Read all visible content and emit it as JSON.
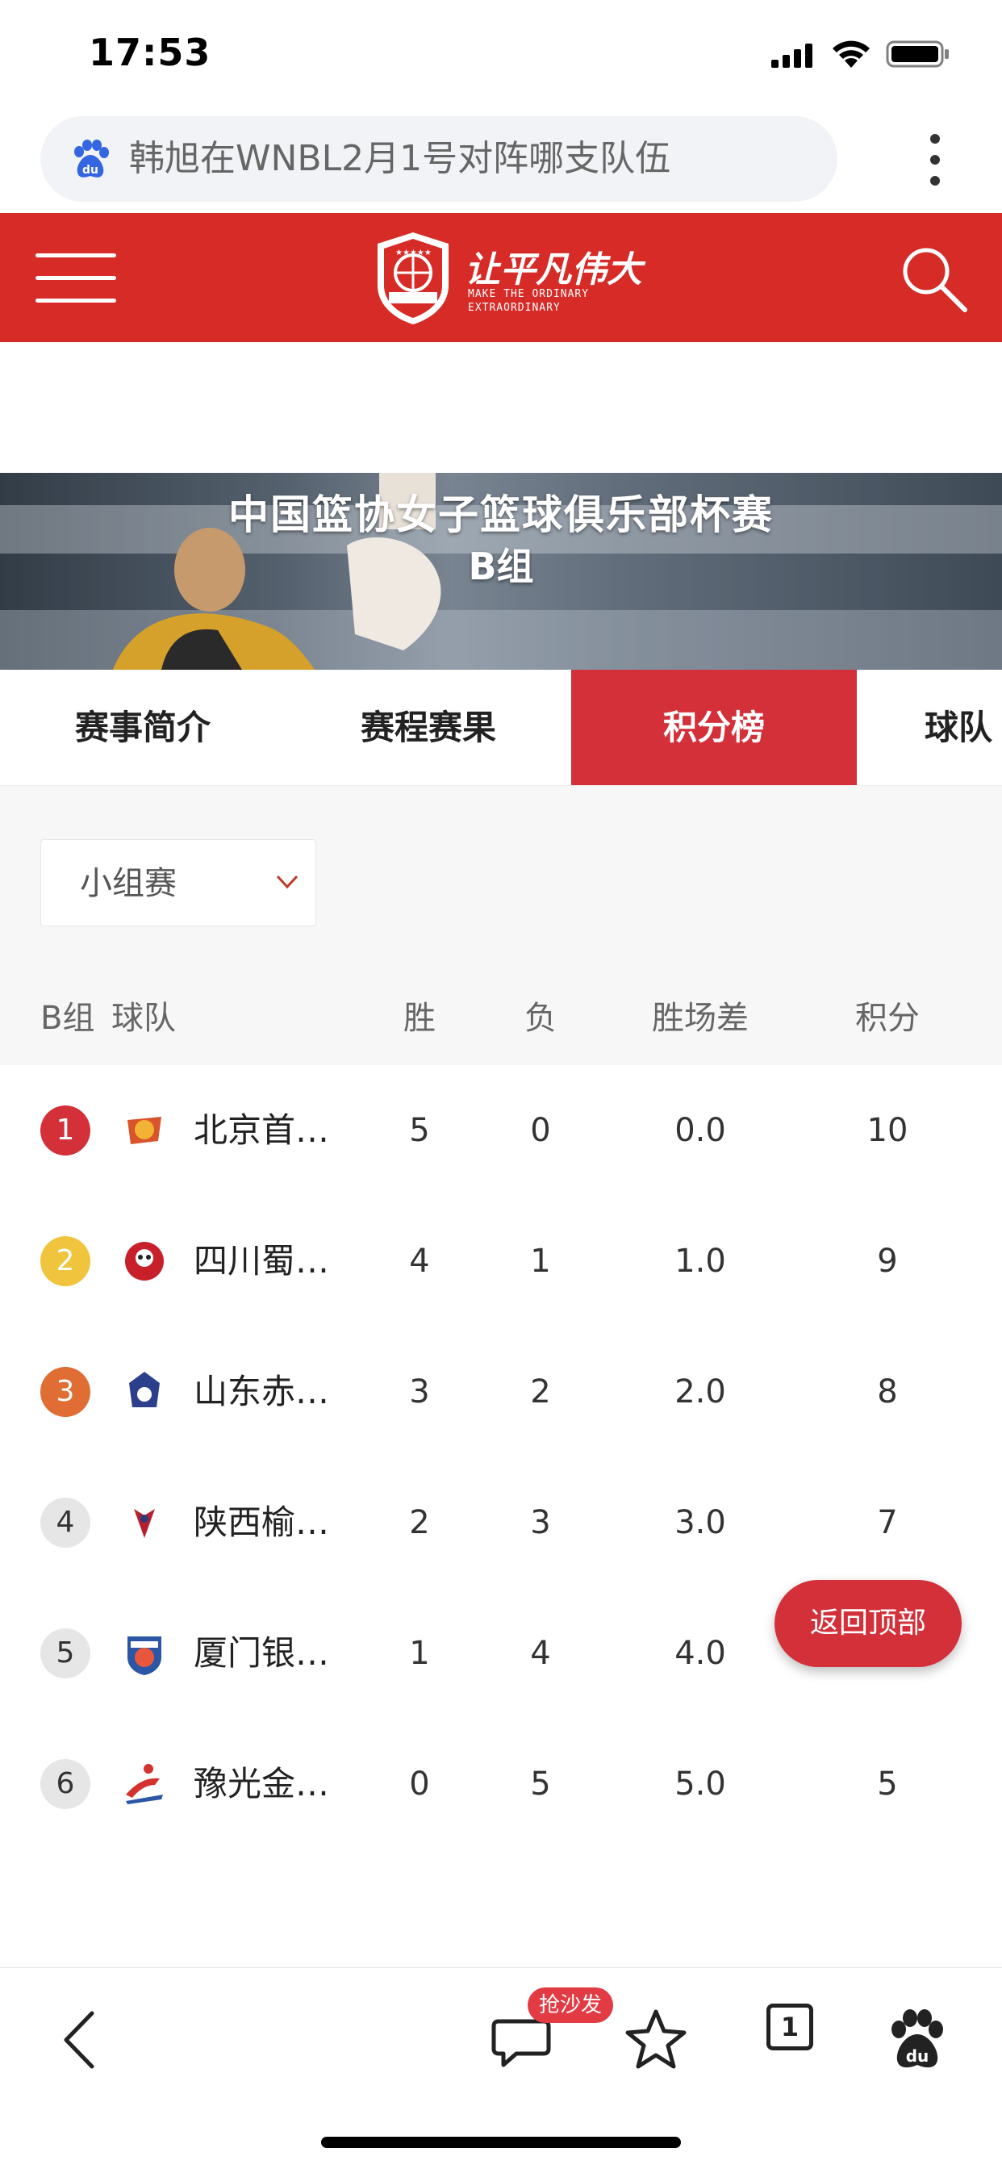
{
  "status_bar": {
    "time": "17:53"
  },
  "address_bar": {
    "search_query": "韩旭在WNBL2月1号对阵哪支队伍"
  },
  "site_header": {
    "slogan": "让平凡伟大",
    "slogan_sub": "MAKE THE ORDINARY\nEXTRAORDINARY",
    "brand_color": "#d62b26"
  },
  "banner": {
    "title": "中国篮协女子篮球俱乐部杯赛",
    "subtitle": "B组"
  },
  "tabs": [
    {
      "label": "赛事简介",
      "active": false
    },
    {
      "label": "赛程赛果",
      "active": false
    },
    {
      "label": "积分榜",
      "active": true
    },
    {
      "label": "球队",
      "active": false
    }
  ],
  "stage_select": {
    "value": "小组赛"
  },
  "table": {
    "headers": {
      "group": "B组",
      "team": "球队",
      "wins": "胜",
      "losses": "负",
      "games_behind": "胜场差",
      "points": "积分"
    },
    "rows": [
      {
        "rank": "1",
        "rank_color": "#d3303a",
        "team": "北京首…",
        "logo_color": "#d9532b",
        "wins": "5",
        "losses": "0",
        "games_behind": "0.0",
        "points": "10"
      },
      {
        "rank": "2",
        "rank_color": "#f0c43d",
        "team": "四川蜀…",
        "logo_color": "#c8202a",
        "wins": "4",
        "losses": "1",
        "games_behind": "1.0",
        "points": "9"
      },
      {
        "rank": "3",
        "rank_color": "#e06d33",
        "team": "山东赤…",
        "logo_color": "#2c3f8c",
        "wins": "3",
        "losses": "2",
        "games_behind": "2.0",
        "points": "8"
      },
      {
        "rank": "4",
        "rank_color": "#e6e6e6",
        "team": "陕西榆…",
        "logo_color": "#b5202e",
        "wins": "2",
        "losses": "3",
        "games_behind": "3.0",
        "points": "7"
      },
      {
        "rank": "5",
        "rank_color": "#e6e6e6",
        "team": "厦门银…",
        "logo_color": "#2b56a6",
        "wins": "1",
        "losses": "4",
        "games_behind": "4.0",
        "points": ""
      },
      {
        "rank": "6",
        "rank_color": "#e6e6e6",
        "team": "豫光金…",
        "logo_color": "#d2332f",
        "wins": "0",
        "losses": "5",
        "games_behind": "5.0",
        "points": "5"
      }
    ]
  },
  "back_to_top": {
    "label": "返回顶部"
  },
  "bottom_bar": {
    "comment_badge": "抢沙发",
    "tab_count": "1"
  },
  "colors": {
    "accent": "#d3303a",
    "gold": "#f0c43d",
    "orange": "#e06d33"
  }
}
